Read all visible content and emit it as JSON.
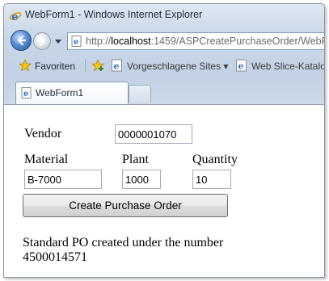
{
  "window": {
    "title": "WebForm1 - Windows Internet Explorer"
  },
  "address": {
    "prefix": "http://",
    "host": "localhost",
    "rest": ":1459/ASPCreatePurchaseOrder/WebF"
  },
  "favorites_bar": {
    "favorites_label": "Favoriten",
    "suggested_sites_label": "Vorgeschlagene Sites ▾",
    "web_slice_label": "Web Slice-Katalog"
  },
  "tabs": [
    {
      "label": "WebForm1"
    }
  ],
  "form": {
    "vendor_label": "Vendor",
    "vendor_value": "0000001070",
    "material_label": "Material",
    "material_value": "B-7000",
    "plant_label": "Plant",
    "plant_value": "1000",
    "quantity_label": "Quantity",
    "quantity_value": "10",
    "submit_label": "Create Purchase Order"
  },
  "result": {
    "message": "Standard PO created under the number",
    "po_number": "4500014571"
  },
  "icons": {
    "ie": "ie-logo-icon",
    "back": "back-arrow-icon",
    "forward": "forward-arrow-icon",
    "favorites": "star-icon"
  },
  "colors": {
    "chrome": "#c9d7e8",
    "address_border": "#7f9db9",
    "ie_blue": "#2a6fd0"
  }
}
